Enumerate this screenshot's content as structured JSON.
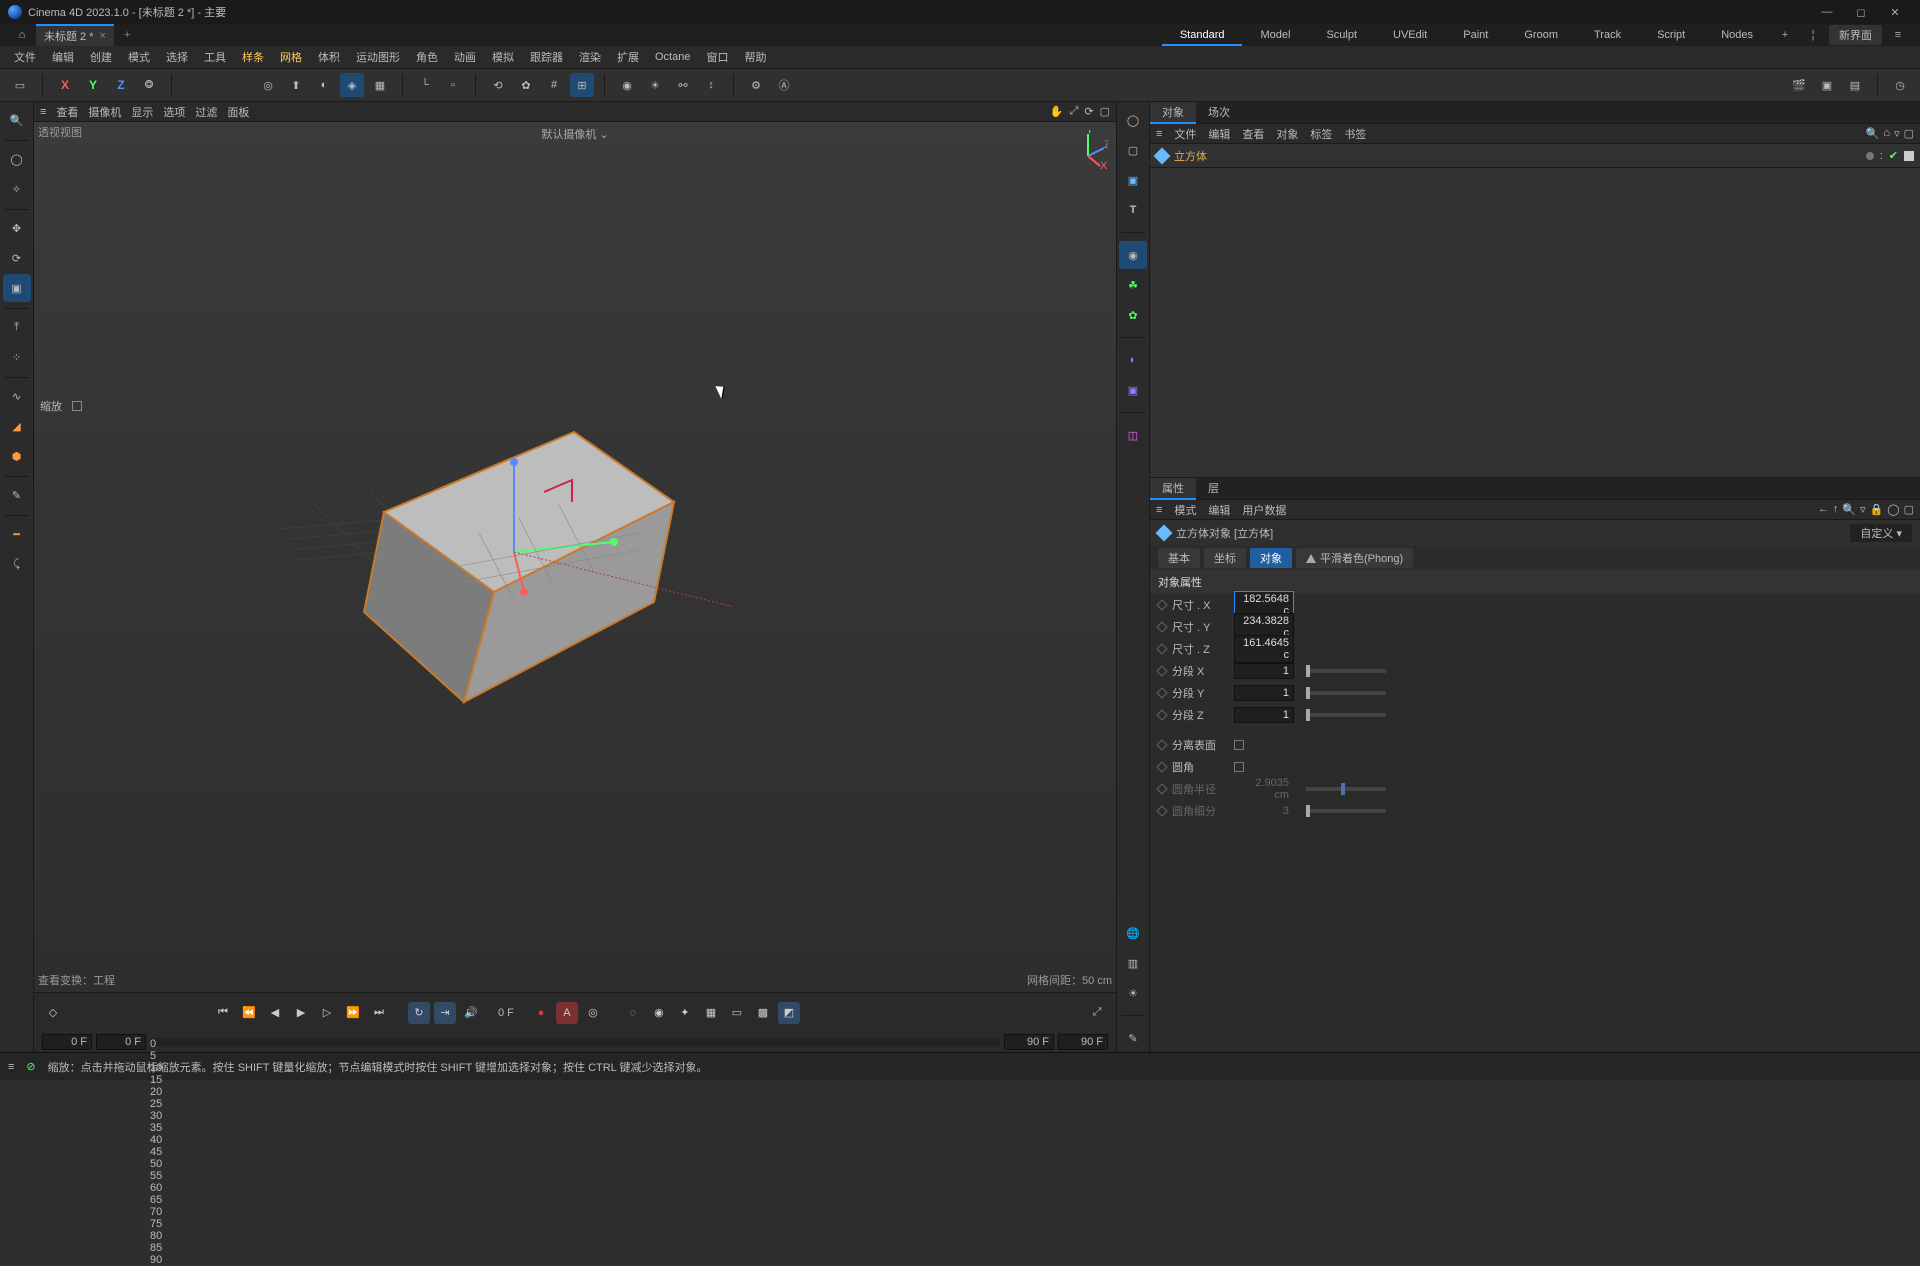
{
  "title": "Cinema 4D 2023.1.0 - [未标题 2 *] - 主要",
  "doc_tab": "未标题 2 *",
  "layouts": [
    "Standard",
    "Model",
    "Sculpt",
    "UVEdit",
    "Paint",
    "Groom",
    "Track",
    "Script",
    "Nodes"
  ],
  "layout_active": "Standard",
  "layout_chip": "新界面",
  "menu": [
    "文件",
    "编辑",
    "创建",
    "模式",
    "选择",
    "工具",
    "样条",
    "网格",
    "体积",
    "运动图形",
    "角色",
    "动画",
    "模拟",
    "跟踪器",
    "渲染",
    "扩展",
    "Octane",
    "窗口",
    "帮助"
  ],
  "menu_hl": [
    "样条",
    "网格"
  ],
  "axes": [
    "X",
    "Y",
    "Z"
  ],
  "vp_menu": [
    "查看",
    "摄像机",
    "显示",
    "选项",
    "过滤",
    "面板"
  ],
  "vp_menu_icon": "≡",
  "vp_hand_icon": "✋",
  "vp_rotate_icon": "⟳",
  "vp_label": "透视视图",
  "vp_camera": "默认摄像机 ⌄",
  "vp_bottom_left": "查看变换：工程",
  "vp_bottom_right": "网格间距：50 cm",
  "vp_scale_label": "缩放",
  "rp_tabs": [
    "对象",
    "场次"
  ],
  "rp_menu": [
    "文件",
    "编辑",
    "查看",
    "对象",
    "标签",
    "书签"
  ],
  "tree_item": "立方体",
  "attr_tabs": [
    "属性",
    "层"
  ],
  "attr_menu": [
    "模式",
    "编辑",
    "用户数据"
  ],
  "attr_title": "立方体对象 [立方体]",
  "attr_sel": "自定义",
  "pills": [
    "基本",
    "坐标",
    "对象",
    "平滑着色(Phong)"
  ],
  "pill_active": "对象",
  "sec_header": "对象属性",
  "props": {
    "size_x": {
      "lbl": "尺寸 . X",
      "val": "182.5648 c"
    },
    "size_y": {
      "lbl": "尺寸 . Y",
      "val": "234.3828 c"
    },
    "size_z": {
      "lbl": "尺寸 . Z",
      "val": "161.4645 c"
    },
    "seg_x": {
      "lbl": "分段 X",
      "val": "1"
    },
    "seg_y": {
      "lbl": "分段 Y",
      "val": "1"
    },
    "seg_z": {
      "lbl": "分段 Z",
      "val": "1"
    },
    "sep": {
      "lbl": "分离表面"
    },
    "fillet": {
      "lbl": "圆角"
    },
    "fr": {
      "lbl": "圆角半径",
      "val": "2.9035 cm"
    },
    "fs": {
      "lbl": "圆角细分",
      "val": "3"
    }
  },
  "timeline": {
    "current": "0 F",
    "ruler": [
      "0",
      "5",
      "10",
      "15",
      "20",
      "25",
      "30",
      "35",
      "40",
      "45",
      "50",
      "55",
      "60",
      "65",
      "70",
      "75",
      "80",
      "85",
      "90"
    ],
    "start1": "0 F",
    "start2": "0 F",
    "end1": "90 F",
    "end2": "90 F"
  },
  "status": "缩放：点击并拖动鼠标缩放元素。按住 SHIFT 键量化缩放；节点编辑模式时按住 SHIFT 键增加选择对象；按住 CTRL 键减少选择对象。"
}
